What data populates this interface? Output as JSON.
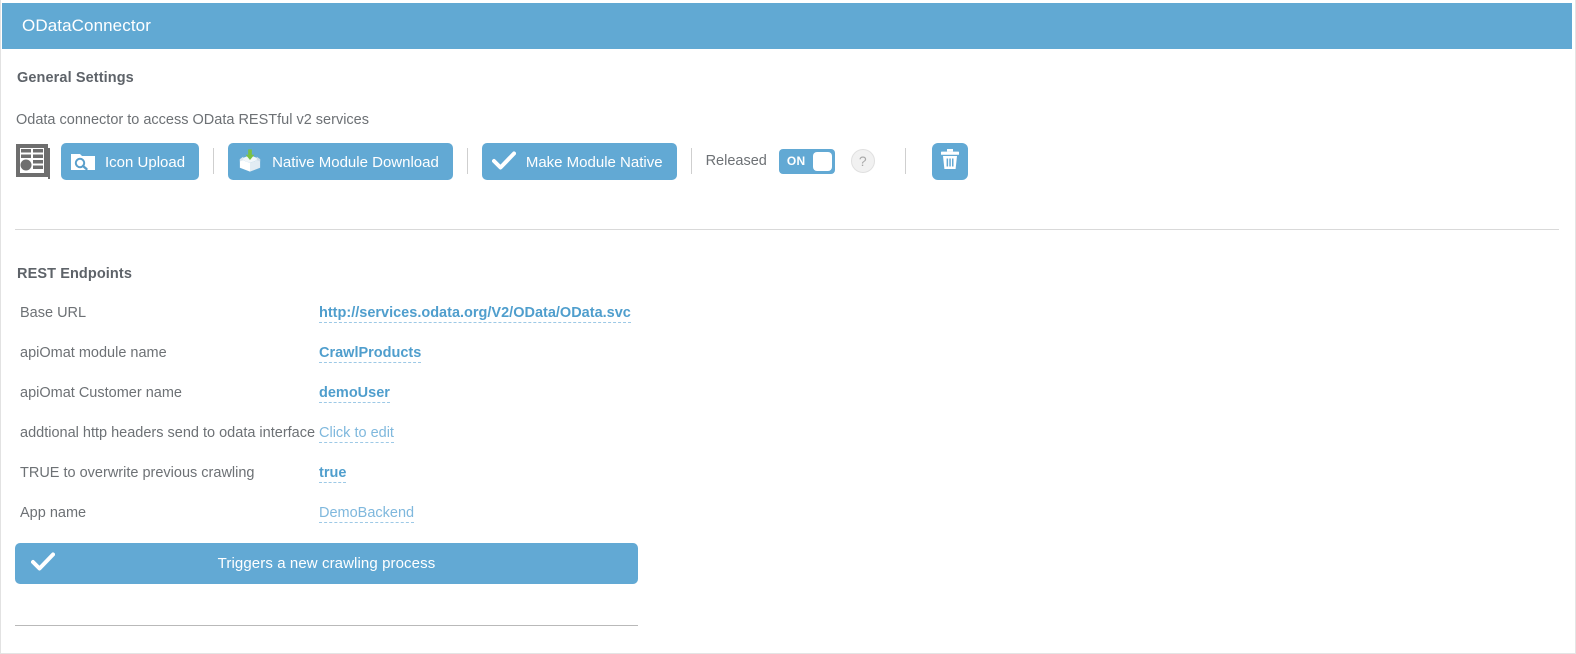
{
  "window": {
    "title": "ODataConnector"
  },
  "general": {
    "heading": "General Settings",
    "description": "Odata connector to access OData RESTful v2 services",
    "module_icon": "module-list-icon",
    "buttons": [
      {
        "label": "Icon Upload",
        "icon": "folder-search-icon"
      },
      {
        "label": "Native Module Download",
        "icon": "box-download-icon"
      },
      {
        "label": "Make Module Native",
        "icon": "checkmark-icon"
      }
    ],
    "released": {
      "label": "Released",
      "toggle_state": "ON",
      "help_glyph": "?"
    },
    "delete_icon": "trash-icon"
  },
  "rest": {
    "heading": "REST Endpoints",
    "rows": [
      {
        "label": "Base URL",
        "value": "http://services.odata.org/V2/OData/OData.svc",
        "style": "strong"
      },
      {
        "label": "apiOmat module name",
        "value": "CrawlProducts",
        "style": "strong"
      },
      {
        "label": "apiOmat Customer name",
        "value": "demoUser",
        "style": "strong"
      },
      {
        "label": "addtional http headers send to odata interface",
        "value": "Click to edit",
        "style": "muted"
      },
      {
        "label": "TRUE to overwrite previous crawling",
        "value": "true",
        "style": "strong"
      },
      {
        "label": "App name",
        "value": "DemoBackend",
        "style": "muted"
      }
    ],
    "action": {
      "label": "Triggers a new crawling process",
      "icon": "checkmark-icon"
    }
  },
  "colors": {
    "accent_blue": "#62a9d4",
    "header_blue": "#61a9d3",
    "link_blue": "#5ba3d0",
    "text_gray": "#6d7175",
    "heading_gray": "#5e6369",
    "download_arrow_green": "#7ac143"
  }
}
